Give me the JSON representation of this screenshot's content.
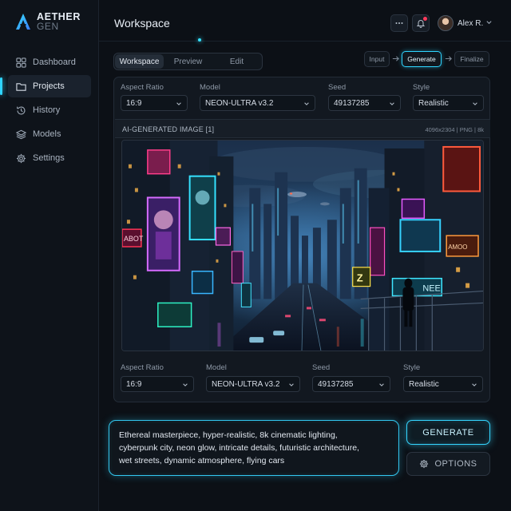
{
  "brand": {
    "name_line1": "AETHER",
    "name_line2": "GEN"
  },
  "sidebar": {
    "items": [
      {
        "label": "Dashboard",
        "icon": "grid-icon"
      },
      {
        "label": "Projects",
        "icon": "folder-icon",
        "active": true
      },
      {
        "label": "History",
        "icon": "history-icon"
      },
      {
        "label": "Models",
        "icon": "layers-icon"
      },
      {
        "label": "Settings",
        "icon": "gear-icon"
      }
    ]
  },
  "header": {
    "title": "Workspace",
    "user_name": "Alex R."
  },
  "tabs": [
    {
      "label": "Workspace",
      "active": true
    },
    {
      "label": "Preview"
    },
    {
      "label": "Edit"
    }
  ],
  "stepper": [
    {
      "label": "Input"
    },
    {
      "label": "Generate",
      "active": true
    },
    {
      "label": "Finalize"
    }
  ],
  "settings_top": {
    "aspect_ratio": {
      "label": "Aspect Ratio",
      "value": "16:9"
    },
    "model": {
      "label": "Model",
      "value": "NEON-ULTRA v3.2"
    },
    "seed": {
      "label": "Seed",
      "value": "49137285"
    },
    "style": {
      "label": "Style",
      "value": "Realistic"
    }
  },
  "image": {
    "title": "AI-GENERATED IMAGE [1]",
    "meta": "4096x2304 | PNG | 8k",
    "signs": [
      "ABOT",
      "Z",
      "NEE",
      "AMOO"
    ]
  },
  "settings_bottom": {
    "aspect_ratio": {
      "label": "Aspect Ratio",
      "value": "16:9"
    },
    "model": {
      "label": "Model",
      "value": "NEON-ULTRA v3.2"
    },
    "seed": {
      "label": "Seed",
      "value": "49137285"
    },
    "style": {
      "label": "Style",
      "value": "Realistic"
    }
  },
  "prompt": {
    "line1": "Ethereal masterpiece, hyper-realistic, 8k cinematic lighting,",
    "line2": "cyberpunk city, neon glow, intricate details, futuristic architecture,",
    "line3": "wet streets, dynamic atmosphere, flying cars"
  },
  "actions": {
    "generate_label": "GENERATE",
    "options_label": "OPTIONS"
  },
  "colors": {
    "accent": "#2fd5ff",
    "background": "#0c1016",
    "panel": "#121820",
    "notification": "#ff3b5c"
  }
}
